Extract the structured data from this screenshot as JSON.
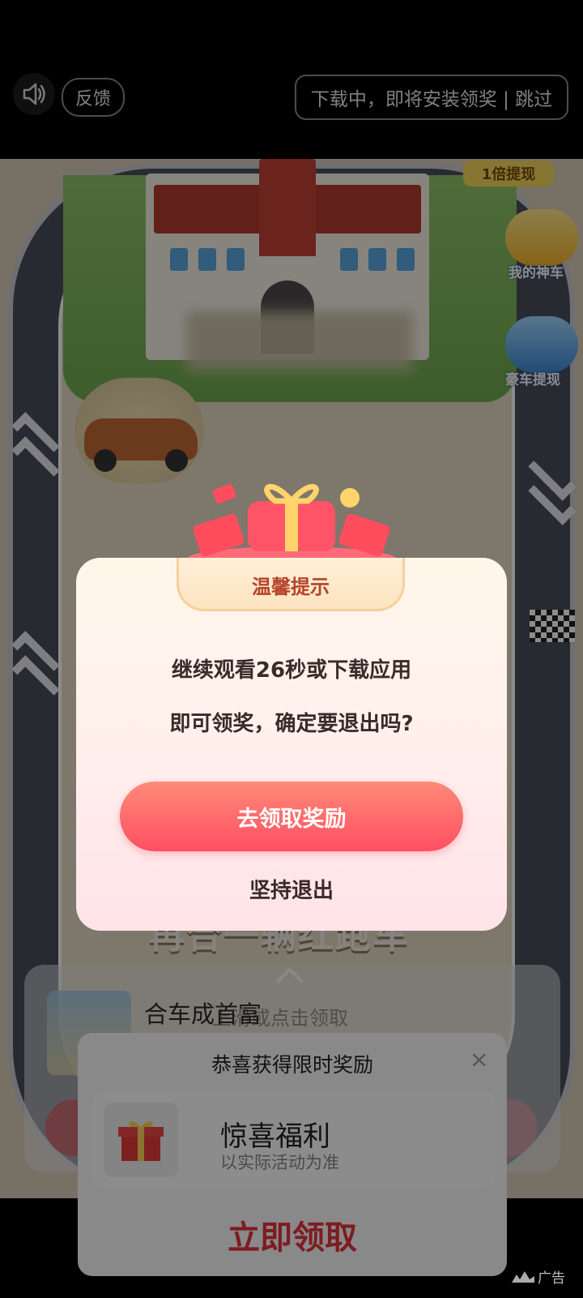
{
  "topbar": {
    "feedback_label": "反馈",
    "skip_label": "下载中，即将安装领奖 | 跳过"
  },
  "game": {
    "tag_top_right": "1倍提现",
    "side_right_1": "我的神车",
    "side_right_2": "豪车提现",
    "slogan": "再合一辆红跑车"
  },
  "under_card": {
    "title": "合车成首富",
    "hint": "上滑或点击领取"
  },
  "reward_sheet": {
    "title": "恭喜获得限时奖励",
    "close_glyph": "×",
    "gift_name": "惊喜福利",
    "gift_sub": "以实际活动为准",
    "cta": "立即领取"
  },
  "modal": {
    "title": "温馨提示",
    "line1": "继续观看26秒或下载应用",
    "line2": "即可领奖，确定要退出吗?",
    "primary_button": "去领取奖励",
    "secondary_button": "坚持退出"
  },
  "ad_badge": {
    "label": "广告"
  },
  "colors": {
    "primary_gradient_top": "#ff8a78",
    "primary_gradient_bottom": "#ff4f62",
    "modal_title": "#b4452b",
    "cta_red": "#e3343f"
  }
}
